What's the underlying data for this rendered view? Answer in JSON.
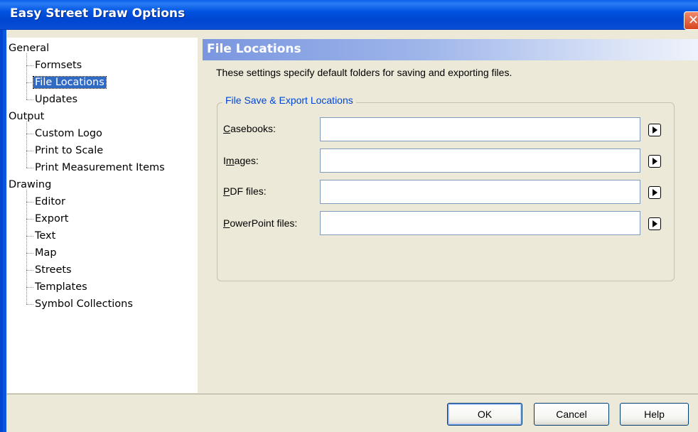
{
  "window": {
    "title": "Easy Street Draw Options",
    "close_glyph": "✕"
  },
  "tree": {
    "items": [
      {
        "label": "General",
        "level": 0
      },
      {
        "label": "Formsets",
        "level": 1
      },
      {
        "label": "File Locations",
        "level": 1,
        "selected": true
      },
      {
        "label": "Updates",
        "level": 1
      },
      {
        "label": "Output",
        "level": 0
      },
      {
        "label": "Custom Logo",
        "level": 1
      },
      {
        "label": "Print to Scale",
        "level": 1
      },
      {
        "label": "Print Measurement Items",
        "level": 1
      },
      {
        "label": "Drawing",
        "level": 0
      },
      {
        "label": "Editor",
        "level": 1
      },
      {
        "label": "Export",
        "level": 1
      },
      {
        "label": "Text",
        "level": 1
      },
      {
        "label": "Map",
        "level": 1
      },
      {
        "label": "Streets",
        "level": 1
      },
      {
        "label": "Templates",
        "level": 1
      },
      {
        "label": "Symbol Collections",
        "level": 1
      }
    ]
  },
  "panel": {
    "header": "File Locations",
    "description": "These settings specify default folders for saving and exporting files.",
    "group_title": "File Save & Export Locations",
    "fields": [
      {
        "label_pre": "",
        "label_key": "C",
        "label_post": "asebooks:",
        "value": ""
      },
      {
        "label_pre": "I",
        "label_key": "m",
        "label_post": "ages:",
        "value": ""
      },
      {
        "label_pre": "",
        "label_key": "P",
        "label_post": "DF files:",
        "value": ""
      },
      {
        "label_pre": "",
        "label_key": "P",
        "label_post": "owerPoint files:",
        "value": ""
      }
    ]
  },
  "buttons": {
    "ok": "OK",
    "cancel": "Cancel",
    "help": "Help"
  },
  "colors": {
    "titlebar": "#0053E0",
    "selection": "#316AC5",
    "group_title": "#0046D5",
    "dialog_bg": "#ECE9D8"
  }
}
